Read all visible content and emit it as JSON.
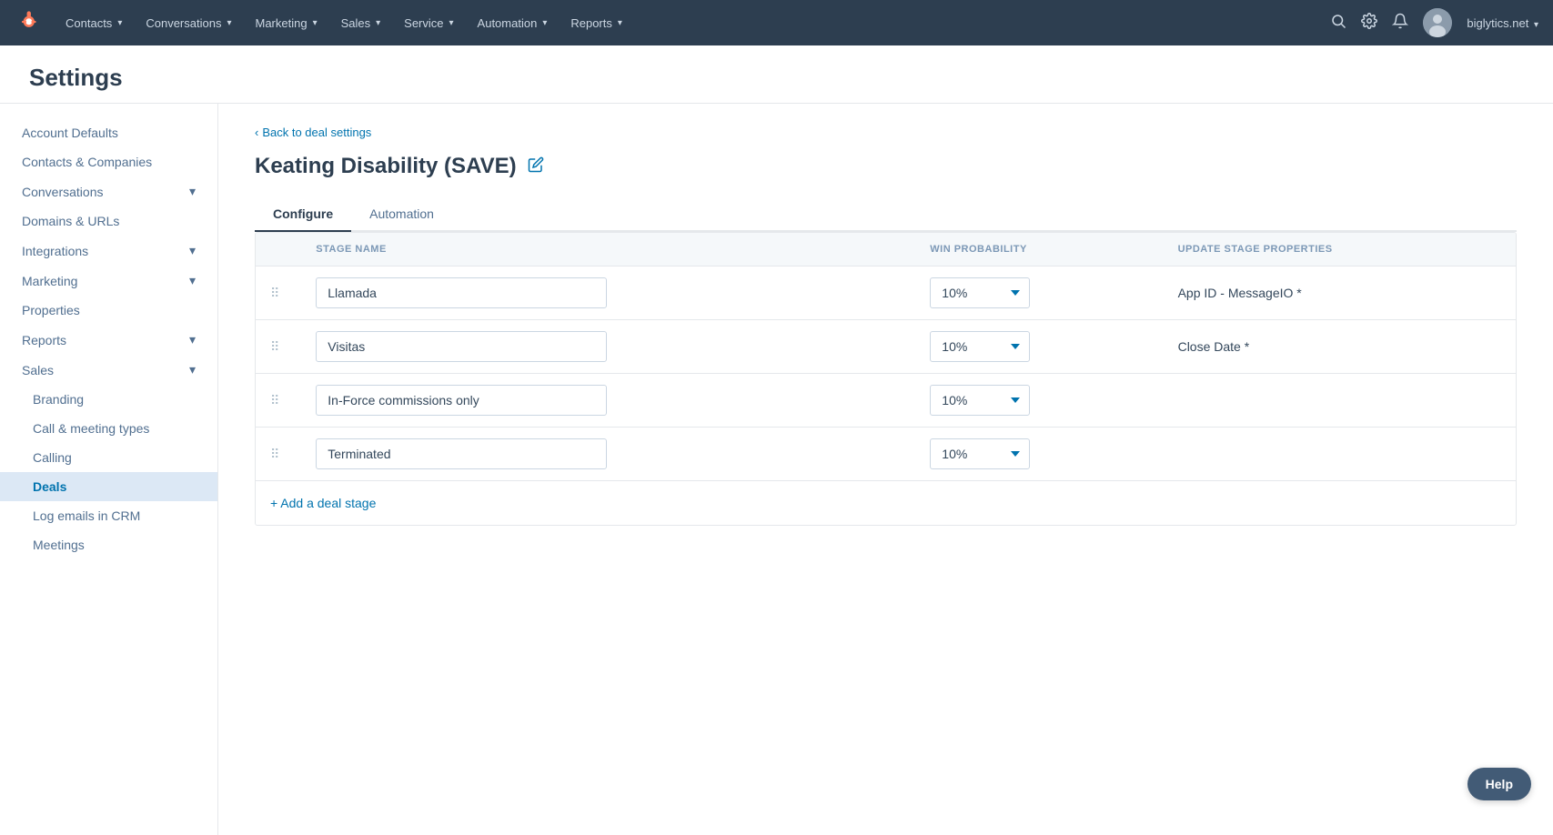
{
  "topnav": {
    "logo": "H",
    "items": [
      {
        "label": "Contacts",
        "id": "contacts"
      },
      {
        "label": "Conversations",
        "id": "conversations"
      },
      {
        "label": "Marketing",
        "id": "marketing"
      },
      {
        "label": "Sales",
        "id": "sales"
      },
      {
        "label": "Service",
        "id": "service"
      },
      {
        "label": "Automation",
        "id": "automation"
      },
      {
        "label": "Reports",
        "id": "reports"
      }
    ],
    "domain": "biglytics.net"
  },
  "settings": {
    "title": "Settings"
  },
  "sidebar": {
    "items": [
      {
        "label": "Account Defaults",
        "id": "account-defaults",
        "active": false,
        "sub": false
      },
      {
        "label": "Contacts & Companies",
        "id": "contacts-companies",
        "active": false,
        "sub": false
      },
      {
        "label": "Conversations",
        "id": "conversations",
        "active": false,
        "sub": false,
        "hasChevron": true
      },
      {
        "label": "Domains & URLs",
        "id": "domains-urls",
        "active": false,
        "sub": false
      },
      {
        "label": "Integrations",
        "id": "integrations",
        "active": false,
        "sub": false,
        "hasChevron": true
      },
      {
        "label": "Marketing",
        "id": "marketing",
        "active": false,
        "sub": false,
        "hasChevron": true
      },
      {
        "label": "Properties",
        "id": "properties",
        "active": false,
        "sub": false
      },
      {
        "label": "Reports",
        "id": "reports",
        "active": false,
        "sub": false,
        "hasChevron": true
      },
      {
        "label": "Sales",
        "id": "sales",
        "active": false,
        "sub": false,
        "hasChevron": true
      },
      {
        "label": "Branding",
        "id": "branding",
        "active": false,
        "sub": true
      },
      {
        "label": "Call & meeting types",
        "id": "call-meeting-types",
        "active": false,
        "sub": true
      },
      {
        "label": "Calling",
        "id": "calling",
        "active": false,
        "sub": true
      },
      {
        "label": "Deals",
        "id": "deals",
        "active": true,
        "sub": true
      },
      {
        "label": "Log emails in CRM",
        "id": "log-emails",
        "active": false,
        "sub": true
      },
      {
        "label": "Meetings",
        "id": "meetings",
        "active": false,
        "sub": true
      }
    ]
  },
  "content": {
    "back_link": "Back to deal settings",
    "page_title": "Keating Disability (SAVE)",
    "tabs": [
      {
        "label": "Configure",
        "id": "configure",
        "active": true
      },
      {
        "label": "Automation",
        "id": "automation",
        "active": false
      }
    ],
    "table": {
      "columns": [
        {
          "label": "STAGE NAME",
          "id": "stage-name"
        },
        {
          "label": "WIN PROBABILITY",
          "id": "win-probability"
        },
        {
          "label": "UPDATE STAGE PROPERTIES",
          "id": "update-stage-properties"
        }
      ],
      "rows": [
        {
          "id": "row-llamada",
          "stage_name": "Llamada",
          "win_probability": "10%",
          "update_stage_property": "App ID - MessageIO *"
        },
        {
          "id": "row-visitas",
          "stage_name": "Visitas",
          "win_probability": "10%",
          "update_stage_property": "Close Date *"
        },
        {
          "id": "row-inforce",
          "stage_name": "In-Force commissions only",
          "win_probability": "10%",
          "update_stage_property": ""
        },
        {
          "id": "row-terminated",
          "stage_name": "Terminated",
          "win_probability": "10%",
          "update_stage_property": ""
        }
      ]
    },
    "add_stage_label": "+ Add a deal stage"
  },
  "help": {
    "label": "Help"
  },
  "colors": {
    "accent": "#0073ae",
    "nav_bg": "#2d3e50",
    "orange": "#ff7a59"
  }
}
